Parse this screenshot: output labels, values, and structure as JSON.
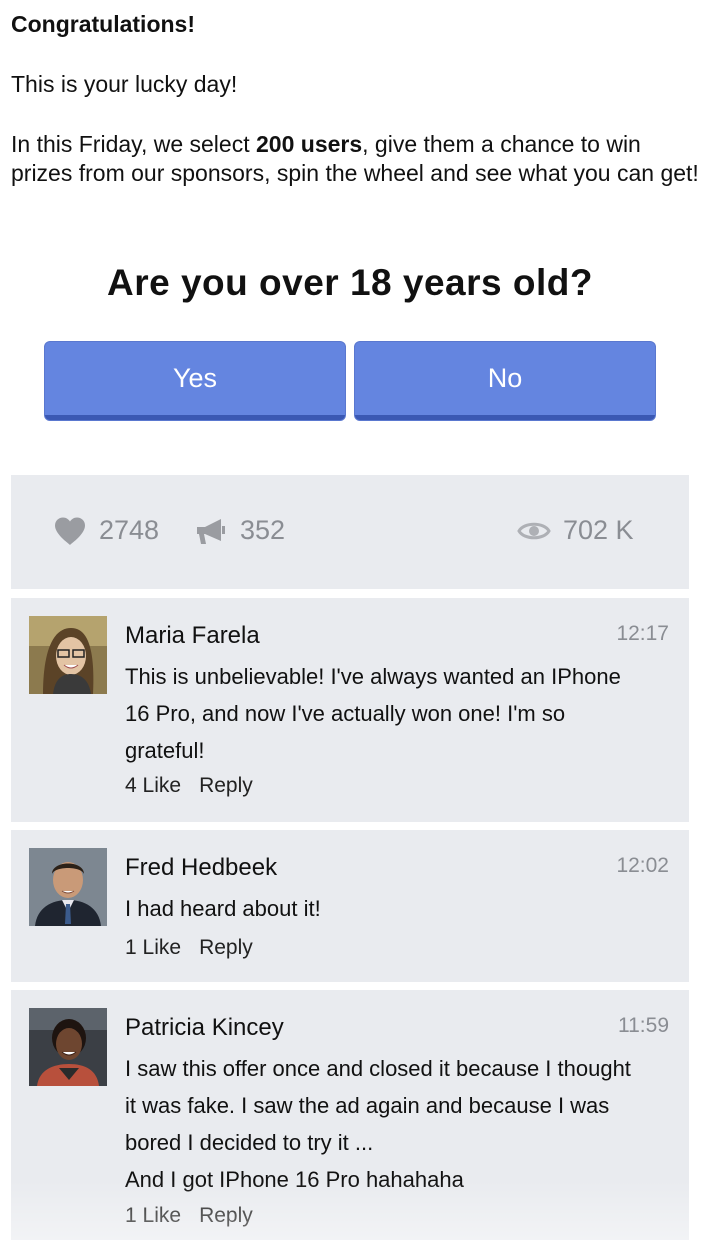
{
  "intro": {
    "heading": "Congratulations!",
    "lucky": "This is your lucky day!",
    "text_before": "In this Friday, we select ",
    "text_bold": "200 users",
    "text_after": ", give them a chance to win prizes from our sponsors, spin the wheel and see what you can get!"
  },
  "question": "Are you over 18 years old?",
  "buttons": {
    "yes": "Yes",
    "no": "No"
  },
  "stats": {
    "likes": "2748",
    "shares": "352",
    "views": "702 K",
    "icons": [
      "heart-icon",
      "megaphone-icon",
      "eye-icon"
    ]
  },
  "comments": [
    {
      "name": "Maria Farela",
      "time": "12:17",
      "text": "This is unbelievable! I've always wanted an IPhone 16 Pro, and now I've actually won one! I'm so grateful!",
      "likes": "4",
      "like_label": "Like",
      "reply_label": "Reply"
    },
    {
      "name": "Fred Hedbeek",
      "time": "12:02",
      "text": "I had heard about it!",
      "likes": "1",
      "like_label": "Like",
      "reply_label": "Reply"
    },
    {
      "name": "Patricia Kincey",
      "time": "11:59",
      "text": "I saw this offer once and closed it because I thought it was fake. I saw the ad again and because I was bored I decided to try it ...",
      "text2": "And I got IPhone 16 Pro hahahaha",
      "likes": "1",
      "like_label": "Like",
      "reply_label": "Reply"
    }
  ],
  "colors": {
    "button": "#6485e0",
    "button_border": "#3a58b3",
    "panel": "#e9ebef",
    "muted": "#8a8d93"
  }
}
